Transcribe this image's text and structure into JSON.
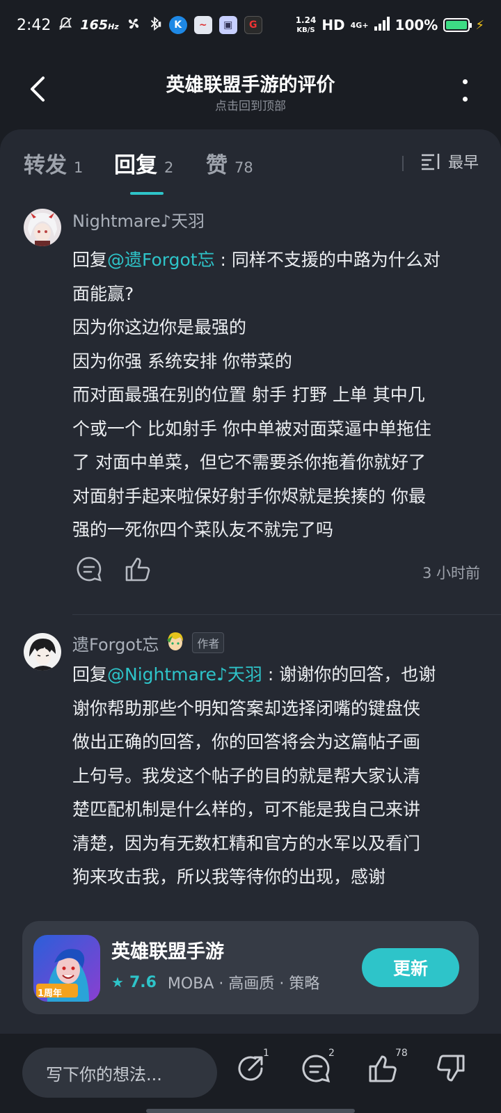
{
  "status_bar": {
    "time": "2:42",
    "refresh_rate": "165",
    "refresh_unit": "Hz",
    "net_speed_value": "1.24",
    "net_speed_unit": "KB/S",
    "hd": "HD",
    "network": "4G+",
    "battery": "100%"
  },
  "header": {
    "title": "英雄联盟手游的评价",
    "subtitle": "点击回到顶部"
  },
  "tabs": [
    {
      "label": "转发",
      "count": "1"
    },
    {
      "label": "回复",
      "count": "2"
    },
    {
      "label": "赞",
      "count": "78"
    }
  ],
  "sort": {
    "label": "最早"
  },
  "comments": [
    {
      "username": "Nightmare♪天羽",
      "reply_prefix": "回复",
      "mention": "@遗Forgot忘",
      "lines": [
        " : 同样不支援的中路为什么对",
        "面能赢?",
        "因为你这边你是最强的",
        "因为你强 系统安排 你带菜的",
        "而对面最强在别的位置 射手 打野 上单 其中几",
        "个或一个 比如射手 你中单被对面菜逼中单拖住",
        "了 对面中单菜，但它不需要杀你拖着你就好了",
        "对面射手起来啦保好射手你烬就是挨揍的 你最",
        "强的一死你四个菜队友不就完了吗"
      ],
      "time": "3 小时前"
    },
    {
      "username": "遗Forgot忘",
      "badge": "作者",
      "reply_prefix": "回复",
      "mention": "@Nightmare♪天羽",
      "lines": [
        " : 谢谢你的回答，也谢",
        "谢你帮助那些个明知答案却选择闭嘴的键盘侠",
        "做出正确的回答，你的回答将会为这篇帖子画",
        "上句号。我发这个帖子的目的就是帮大家认清",
        "楚匹配机制是什么样的，可不能是我自己来讲",
        "清楚，因为有无数杠精和官方的水军以及看门",
        "狗来攻击我，所以我等待你的出现，感谢"
      ]
    }
  ],
  "game_card": {
    "name": "英雄联盟手游",
    "rating": "7.6",
    "tags": "MOBA · 高画质 · 策略",
    "button": "更新",
    "icon_badge": "1周年"
  },
  "bottom_bar": {
    "placeholder": "写下你的想法...",
    "share_count": "1",
    "comment_count": "2",
    "like_count": "78"
  },
  "colors": {
    "accent": "#2ec4c9",
    "background": "#1a1d23",
    "sheet": "#252932"
  }
}
